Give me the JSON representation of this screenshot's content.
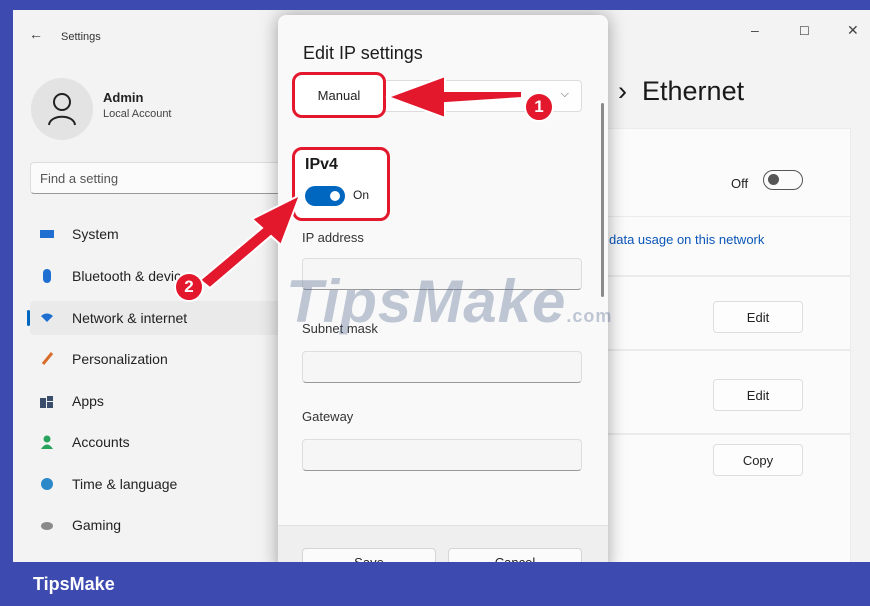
{
  "window": {
    "title": "Settings",
    "back_glyph": "←",
    "minimize_glyph": "–",
    "maximize_glyph": "☐",
    "close_glyph": "✕"
  },
  "user": {
    "name": "Admin",
    "subtitle": "Local Account",
    "icon": "person-icon"
  },
  "search": {
    "placeholder": "Find a setting"
  },
  "sidebar": {
    "items": [
      {
        "label": "System",
        "icon": "monitor-icon",
        "color": "#1f6fd1",
        "active": false
      },
      {
        "label": "Bluetooth & devices",
        "icon": "bluetooth-icon",
        "color": "#1f6fd1",
        "active": false
      },
      {
        "label": "Network & internet",
        "icon": "wifi-icon",
        "color": "#1f6fd1",
        "active": true
      },
      {
        "label": "Personalization",
        "icon": "brush-icon",
        "color": "#d86c2a",
        "active": false
      },
      {
        "label": "Apps",
        "icon": "apps-icon",
        "color": "#3a4d6b",
        "active": false
      },
      {
        "label": "Accounts",
        "icon": "person-icon",
        "color": "#27a35e",
        "active": false
      },
      {
        "label": "Time & language",
        "icon": "globe-icon",
        "color": "#2b88c9",
        "active": false
      },
      {
        "label": "Gaming",
        "icon": "controller-icon",
        "color": "#8a8a8a",
        "active": false
      }
    ]
  },
  "page": {
    "breadcrumb_sep": "›",
    "title": "Ethernet",
    "metered_state": "Off",
    "data_usage_link": "data usage on this network",
    "buttons": [
      "Edit",
      "Edit",
      "Copy"
    ]
  },
  "dialog": {
    "title": "Edit IP settings",
    "mode_value": "Manual",
    "ipv4_title": "IPv4",
    "ipv4_state": "On",
    "fields": {
      "ip_address": "IP address",
      "subnet_mask": "Subnet mask",
      "gateway": "Gateway"
    },
    "save_label": "Save",
    "cancel_label": "Cancel"
  },
  "annotations": {
    "badge_1": "1",
    "badge_2": "2",
    "color": "#e3182d"
  },
  "watermark": {
    "text": "TipsMake",
    "suffix": ".com"
  },
  "footer": {
    "brand": "TipsMake"
  }
}
